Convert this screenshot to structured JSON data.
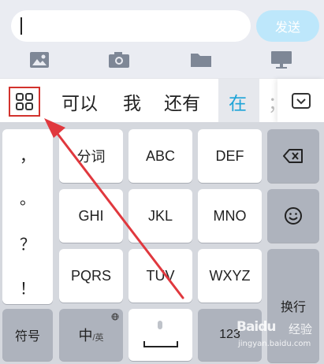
{
  "compose": {
    "input_value": "",
    "send_label": "发送"
  },
  "toolbar": {
    "icons": [
      "image-icon",
      "camera-icon",
      "folder-icon",
      "monitor-icon"
    ]
  },
  "candidates": {
    "words": [
      "可以",
      "我",
      "还有",
      "在"
    ],
    "selected_index": 3,
    "partial": "；"
  },
  "keyboard": {
    "punctuation": [
      "，",
      "。",
      "？",
      "！"
    ],
    "t9_keys": [
      "分词",
      "ABC",
      "DEF",
      "GHI",
      "JKL",
      "MNO",
      "PQRS",
      "TUV",
      "WXYZ"
    ],
    "symbols_label": "符号",
    "lang_main": "中",
    "lang_sub": "/英",
    "space_label": "",
    "numeric_label": "123",
    "enter_label": "换行"
  },
  "watermark": {
    "logo": "Baidu",
    "text": "经验",
    "url": "jingyan.baidu.com"
  },
  "colors": {
    "accent": "#1ea4d8",
    "send_disabled": "#bde7fb",
    "highlight_box": "#d2322d",
    "arrow": "#e0383e"
  }
}
